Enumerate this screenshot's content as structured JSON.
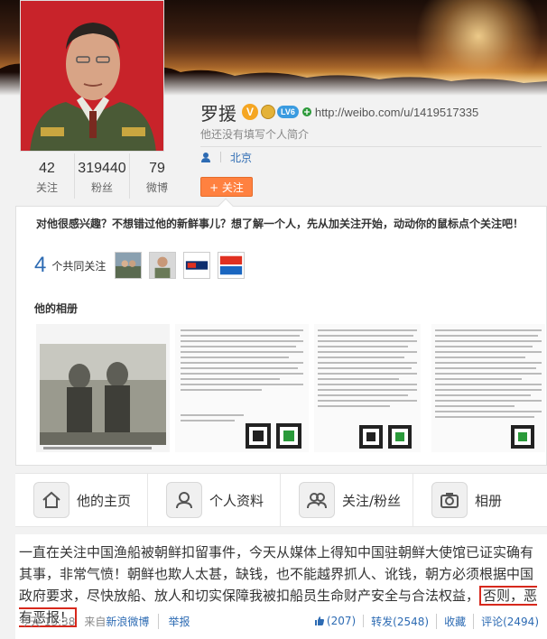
{
  "profile": {
    "name": "罗援",
    "url": "http://weibo.com/u/1419517335",
    "bio": "他还没有填写个人简介",
    "location": "北京",
    "follow_label": "+ 关注",
    "badges": {
      "verified": "V",
      "level": "LV6"
    },
    "stats": [
      {
        "value": "42",
        "label": "关注"
      },
      {
        "value": "319440",
        "label": "粉丝"
      },
      {
        "value": "79",
        "label": "微博"
      }
    ]
  },
  "recommend": {
    "tip": "对他很感兴趣？不想错过他的新鲜事儿？想了解一个人，先从加关注开始，动动你的鼠标点个关注吧！",
    "mutual_count": "4",
    "mutual_label": "个共同关注",
    "album_title": "他的相册"
  },
  "nav": {
    "tabs": [
      {
        "label": "他的主页",
        "icon": "home-icon"
      },
      {
        "label": "个人资料",
        "icon": "profile-icon"
      },
      {
        "label": "关注/粉丝",
        "icon": "followers-icon"
      },
      {
        "label": "相册",
        "icon": "camera-icon"
      }
    ]
  },
  "post": {
    "text_main": "一直在关注中国渔船被朝鲜扣留事件，今天从媒体上得知中国驻朝鲜大使馆已证实确有其事，非常气愤！朝鲜也欺人太甚，缺钱，也不能越界抓人、讹钱，朝方必须根据中国政府要求，尽快放船、放人和切实保障我被扣船员生命财产安全与合法权益，",
    "text_highlight": "否则，恶有恶报！",
    "time": "今天 13:38",
    "source_prefix": "来自",
    "source": "新浪微博",
    "report": "举报",
    "likes": "(207)",
    "repost": "转发(2548)",
    "favorite": "收藏",
    "comment": "评论(2494)"
  },
  "colors": {
    "accent": "#ff8140",
    "link": "#2d6bb3",
    "highlight_border": "#d7281c"
  }
}
